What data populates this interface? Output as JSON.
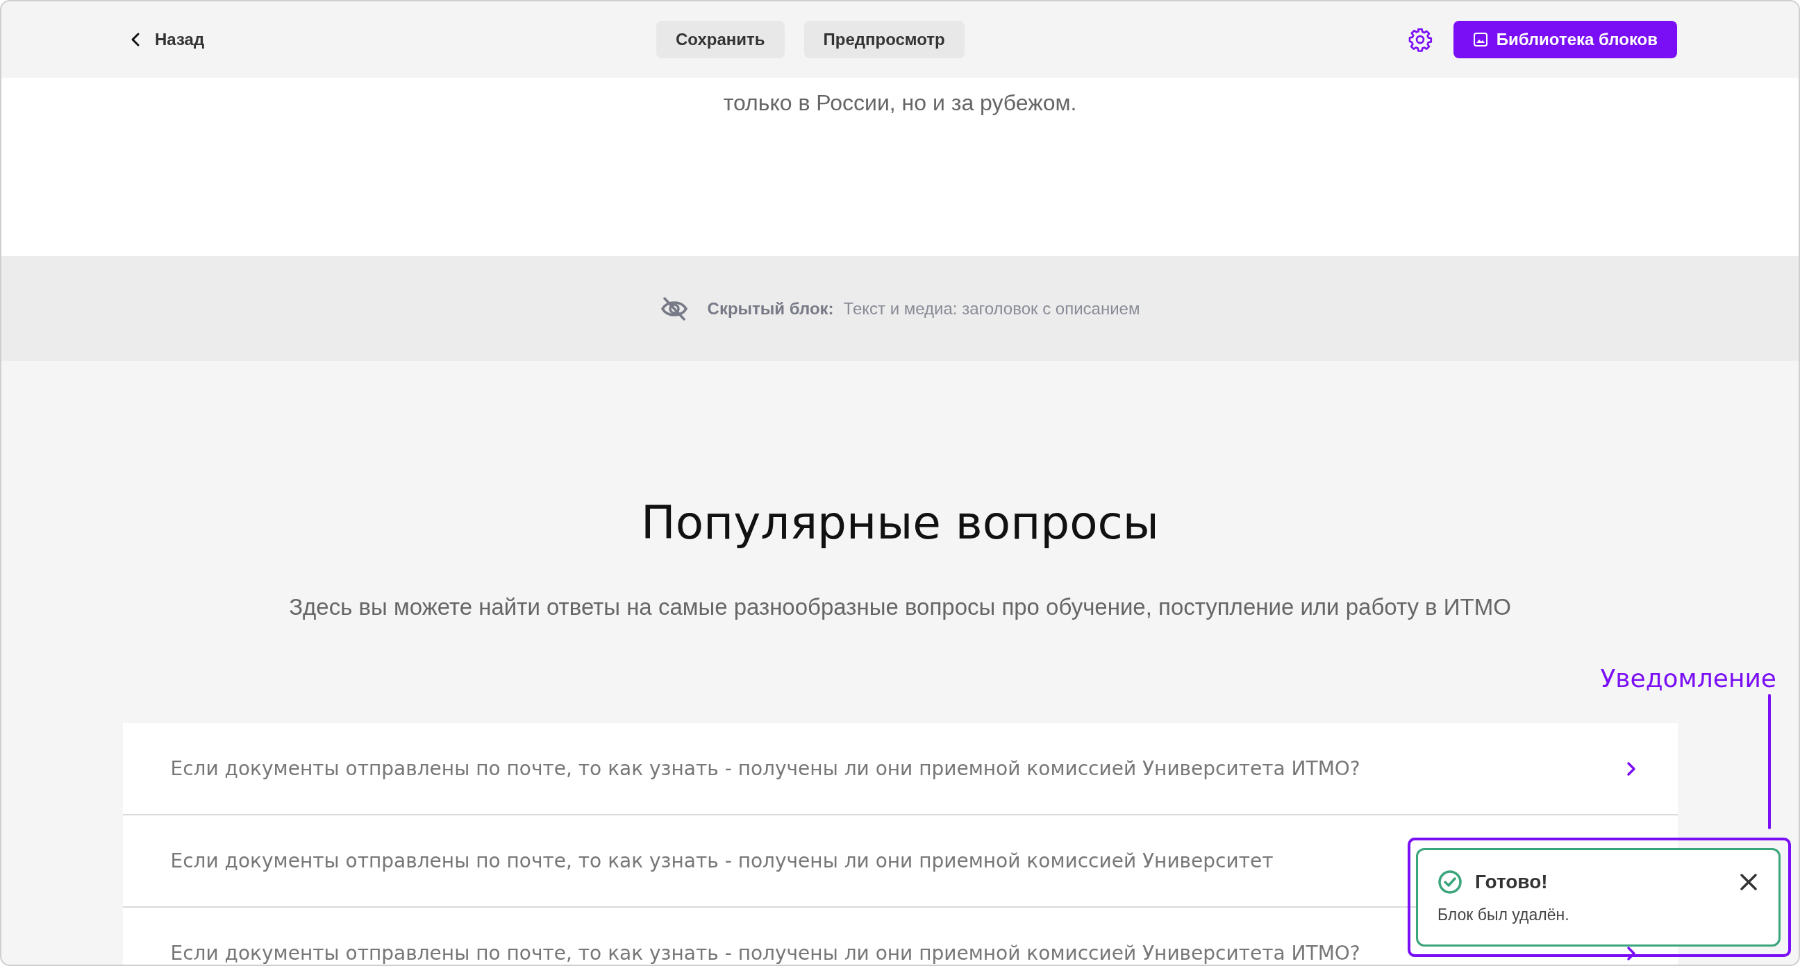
{
  "header": {
    "back": "Назад",
    "buttons": [
      {
        "label": "Сохранить"
      },
      {
        "label": "Предпросмотр"
      }
    ],
    "library_button": "Библиотека блоков"
  },
  "intro_text": "только в России, но и за рубежом.",
  "hidden_block": {
    "label": "Скрытый блок:",
    "description": "Текст и медиа: заголовок с описанием"
  },
  "faq": {
    "title": "Популярные вопросы",
    "subtitle": "Здесь вы можете найти ответы на самые разнообразные вопросы про обучение, поступление или работу в ИТМО",
    "items": [
      {
        "text": "Если документы отправлены по почте, то как узнать - получены ли они приемной комиссией Университета ИТМО?",
        "arrow": true
      },
      {
        "text": "Если документы отправлены по почте, то как узнать - получены ли они приемной комиссией Университет",
        "arrow": false
      },
      {
        "text": "Если документы отправлены по почте, то как узнать - получены ли они приемной комиссией Университета ИТМО?",
        "arrow": true
      }
    ]
  },
  "annotation": "Уведомление",
  "toast": {
    "kind": "success",
    "title": "Готово!",
    "message": "Блок был удалён."
  }
}
